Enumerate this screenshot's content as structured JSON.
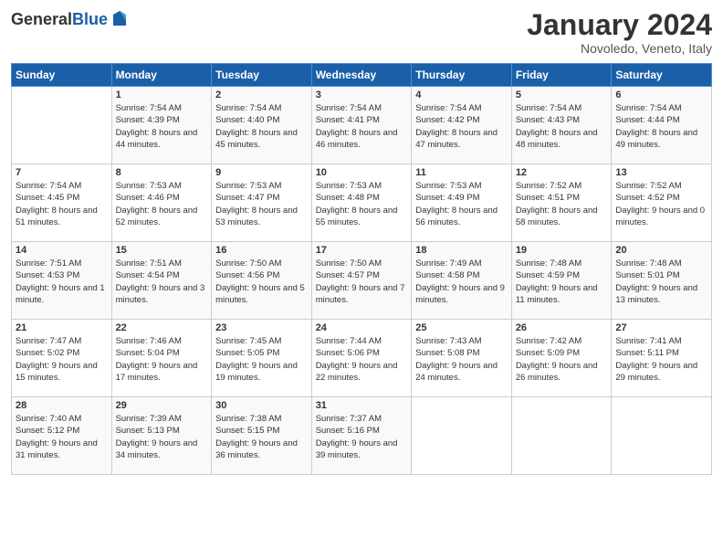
{
  "header": {
    "logo_general": "General",
    "logo_blue": "Blue",
    "month_title": "January 2024",
    "location": "Novoledo, Veneto, Italy"
  },
  "days_of_week": [
    "Sunday",
    "Monday",
    "Tuesday",
    "Wednesday",
    "Thursday",
    "Friday",
    "Saturday"
  ],
  "weeks": [
    [
      {
        "day": "",
        "sunrise": "",
        "sunset": "",
        "daylight": ""
      },
      {
        "day": "1",
        "sunrise": "Sunrise: 7:54 AM",
        "sunset": "Sunset: 4:39 PM",
        "daylight": "Daylight: 8 hours and 44 minutes."
      },
      {
        "day": "2",
        "sunrise": "Sunrise: 7:54 AM",
        "sunset": "Sunset: 4:40 PM",
        "daylight": "Daylight: 8 hours and 45 minutes."
      },
      {
        "day": "3",
        "sunrise": "Sunrise: 7:54 AM",
        "sunset": "Sunset: 4:41 PM",
        "daylight": "Daylight: 8 hours and 46 minutes."
      },
      {
        "day": "4",
        "sunrise": "Sunrise: 7:54 AM",
        "sunset": "Sunset: 4:42 PM",
        "daylight": "Daylight: 8 hours and 47 minutes."
      },
      {
        "day": "5",
        "sunrise": "Sunrise: 7:54 AM",
        "sunset": "Sunset: 4:43 PM",
        "daylight": "Daylight: 8 hours and 48 minutes."
      },
      {
        "day": "6",
        "sunrise": "Sunrise: 7:54 AM",
        "sunset": "Sunset: 4:44 PM",
        "daylight": "Daylight: 8 hours and 49 minutes."
      }
    ],
    [
      {
        "day": "7",
        "sunrise": "Sunrise: 7:54 AM",
        "sunset": "Sunset: 4:45 PM",
        "daylight": "Daylight: 8 hours and 51 minutes."
      },
      {
        "day": "8",
        "sunrise": "Sunrise: 7:53 AM",
        "sunset": "Sunset: 4:46 PM",
        "daylight": "Daylight: 8 hours and 52 minutes."
      },
      {
        "day": "9",
        "sunrise": "Sunrise: 7:53 AM",
        "sunset": "Sunset: 4:47 PM",
        "daylight": "Daylight: 8 hours and 53 minutes."
      },
      {
        "day": "10",
        "sunrise": "Sunrise: 7:53 AM",
        "sunset": "Sunset: 4:48 PM",
        "daylight": "Daylight: 8 hours and 55 minutes."
      },
      {
        "day": "11",
        "sunrise": "Sunrise: 7:53 AM",
        "sunset": "Sunset: 4:49 PM",
        "daylight": "Daylight: 8 hours and 56 minutes."
      },
      {
        "day": "12",
        "sunrise": "Sunrise: 7:52 AM",
        "sunset": "Sunset: 4:51 PM",
        "daylight": "Daylight: 8 hours and 58 minutes."
      },
      {
        "day": "13",
        "sunrise": "Sunrise: 7:52 AM",
        "sunset": "Sunset: 4:52 PM",
        "daylight": "Daylight: 9 hours and 0 minutes."
      }
    ],
    [
      {
        "day": "14",
        "sunrise": "Sunrise: 7:51 AM",
        "sunset": "Sunset: 4:53 PM",
        "daylight": "Daylight: 9 hours and 1 minute."
      },
      {
        "day": "15",
        "sunrise": "Sunrise: 7:51 AM",
        "sunset": "Sunset: 4:54 PM",
        "daylight": "Daylight: 9 hours and 3 minutes."
      },
      {
        "day": "16",
        "sunrise": "Sunrise: 7:50 AM",
        "sunset": "Sunset: 4:56 PM",
        "daylight": "Daylight: 9 hours and 5 minutes."
      },
      {
        "day": "17",
        "sunrise": "Sunrise: 7:50 AM",
        "sunset": "Sunset: 4:57 PM",
        "daylight": "Daylight: 9 hours and 7 minutes."
      },
      {
        "day": "18",
        "sunrise": "Sunrise: 7:49 AM",
        "sunset": "Sunset: 4:58 PM",
        "daylight": "Daylight: 9 hours and 9 minutes."
      },
      {
        "day": "19",
        "sunrise": "Sunrise: 7:48 AM",
        "sunset": "Sunset: 4:59 PM",
        "daylight": "Daylight: 9 hours and 11 minutes."
      },
      {
        "day": "20",
        "sunrise": "Sunrise: 7:48 AM",
        "sunset": "Sunset: 5:01 PM",
        "daylight": "Daylight: 9 hours and 13 minutes."
      }
    ],
    [
      {
        "day": "21",
        "sunrise": "Sunrise: 7:47 AM",
        "sunset": "Sunset: 5:02 PM",
        "daylight": "Daylight: 9 hours and 15 minutes."
      },
      {
        "day": "22",
        "sunrise": "Sunrise: 7:46 AM",
        "sunset": "Sunset: 5:04 PM",
        "daylight": "Daylight: 9 hours and 17 minutes."
      },
      {
        "day": "23",
        "sunrise": "Sunrise: 7:45 AM",
        "sunset": "Sunset: 5:05 PM",
        "daylight": "Daylight: 9 hours and 19 minutes."
      },
      {
        "day": "24",
        "sunrise": "Sunrise: 7:44 AM",
        "sunset": "Sunset: 5:06 PM",
        "daylight": "Daylight: 9 hours and 22 minutes."
      },
      {
        "day": "25",
        "sunrise": "Sunrise: 7:43 AM",
        "sunset": "Sunset: 5:08 PM",
        "daylight": "Daylight: 9 hours and 24 minutes."
      },
      {
        "day": "26",
        "sunrise": "Sunrise: 7:42 AM",
        "sunset": "Sunset: 5:09 PM",
        "daylight": "Daylight: 9 hours and 26 minutes."
      },
      {
        "day": "27",
        "sunrise": "Sunrise: 7:41 AM",
        "sunset": "Sunset: 5:11 PM",
        "daylight": "Daylight: 9 hours and 29 minutes."
      }
    ],
    [
      {
        "day": "28",
        "sunrise": "Sunrise: 7:40 AM",
        "sunset": "Sunset: 5:12 PM",
        "daylight": "Daylight: 9 hours and 31 minutes."
      },
      {
        "day": "29",
        "sunrise": "Sunrise: 7:39 AM",
        "sunset": "Sunset: 5:13 PM",
        "daylight": "Daylight: 9 hours and 34 minutes."
      },
      {
        "day": "30",
        "sunrise": "Sunrise: 7:38 AM",
        "sunset": "Sunset: 5:15 PM",
        "daylight": "Daylight: 9 hours and 36 minutes."
      },
      {
        "day": "31",
        "sunrise": "Sunrise: 7:37 AM",
        "sunset": "Sunset: 5:16 PM",
        "daylight": "Daylight: 9 hours and 39 minutes."
      },
      {
        "day": "",
        "sunrise": "",
        "sunset": "",
        "daylight": ""
      },
      {
        "day": "",
        "sunrise": "",
        "sunset": "",
        "daylight": ""
      },
      {
        "day": "",
        "sunrise": "",
        "sunset": "",
        "daylight": ""
      }
    ]
  ]
}
